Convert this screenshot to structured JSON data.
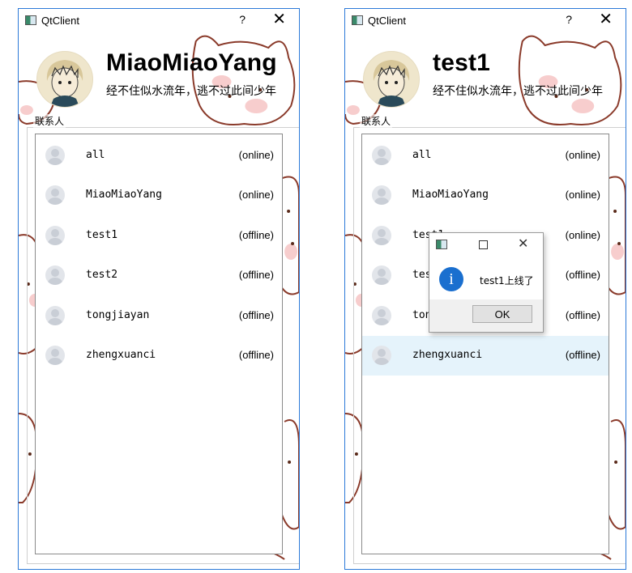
{
  "windows": [
    {
      "title": "QtClient",
      "help_label": "?",
      "close_label": "✕",
      "username": "MiaoMiaoYang",
      "signature": "经不住似水流年，逃不过此间少年",
      "group_label": "联系人",
      "contacts": [
        {
          "name": "all",
          "status": "(online)"
        },
        {
          "name": "MiaoMiaoYang",
          "status": "(online)"
        },
        {
          "name": "test1",
          "status": "(offline)"
        },
        {
          "name": "test2",
          "status": "(offline)"
        },
        {
          "name": "tongjiayan",
          "status": "(offline)"
        },
        {
          "name": "zhengxuanci",
          "status": "(offline)"
        }
      ]
    },
    {
      "title": "QtClient",
      "help_label": "?",
      "close_label": "✕",
      "username": "test1",
      "signature": "经不住似水流年，逃不过此间少年",
      "group_label": "联系人",
      "contacts": [
        {
          "name": "all",
          "status": "(online)"
        },
        {
          "name": "MiaoMiaoYang",
          "status": "(online)"
        },
        {
          "name": "test1",
          "status": "(online)"
        },
        {
          "name": "test2",
          "status": "(offline)"
        },
        {
          "name": "tongjiayan",
          "status": "(offline)"
        },
        {
          "name": "zhengxuanci",
          "status": "(offline)",
          "selected": true
        }
      ],
      "message_box": {
        "icon": "info-icon",
        "info_glyph": "i",
        "text": "test1上线了",
        "close_label": "✕",
        "ok_label": "OK"
      }
    }
  ]
}
